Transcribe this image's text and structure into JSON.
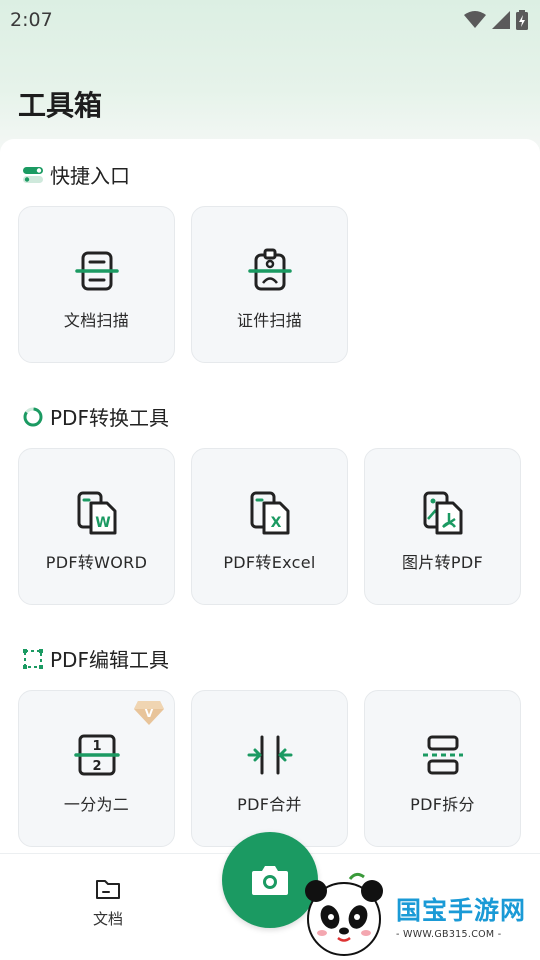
{
  "status": {
    "time": "2:07"
  },
  "app": {
    "title": "工具箱"
  },
  "sections": [
    {
      "title": "快捷入口",
      "icon": "toggle-icon",
      "tools": [
        {
          "label": "文档扫描",
          "icon": "document-scan-icon"
        },
        {
          "label": "证件扫描",
          "icon": "id-card-scan-icon"
        }
      ]
    },
    {
      "title": "PDF转换工具",
      "icon": "convert-ring-icon",
      "tools": [
        {
          "label": "PDF转WORD",
          "icon": "pdf-to-word-icon"
        },
        {
          "label": "PDF转Excel",
          "icon": "pdf-to-excel-icon"
        },
        {
          "label": "图片转PDF",
          "icon": "image-to-pdf-icon"
        }
      ]
    },
    {
      "title": "PDF编辑工具",
      "icon": "edit-frame-icon",
      "tools": [
        {
          "label": "一分为二",
          "icon": "split-in-two-icon",
          "badge": "V"
        },
        {
          "label": "PDF合并",
          "icon": "pdf-merge-icon"
        },
        {
          "label": "PDF拆分",
          "icon": "pdf-split-icon"
        }
      ]
    }
  ],
  "bottom_nav": {
    "docs_label": "文档",
    "camera_icon": "camera-icon"
  },
  "watermark": {
    "brand": "国宝手游网",
    "url": "- WWW.GB315.COM -"
  },
  "colors": {
    "accent": "#1b9a62",
    "brand": "#1a9ad6"
  }
}
